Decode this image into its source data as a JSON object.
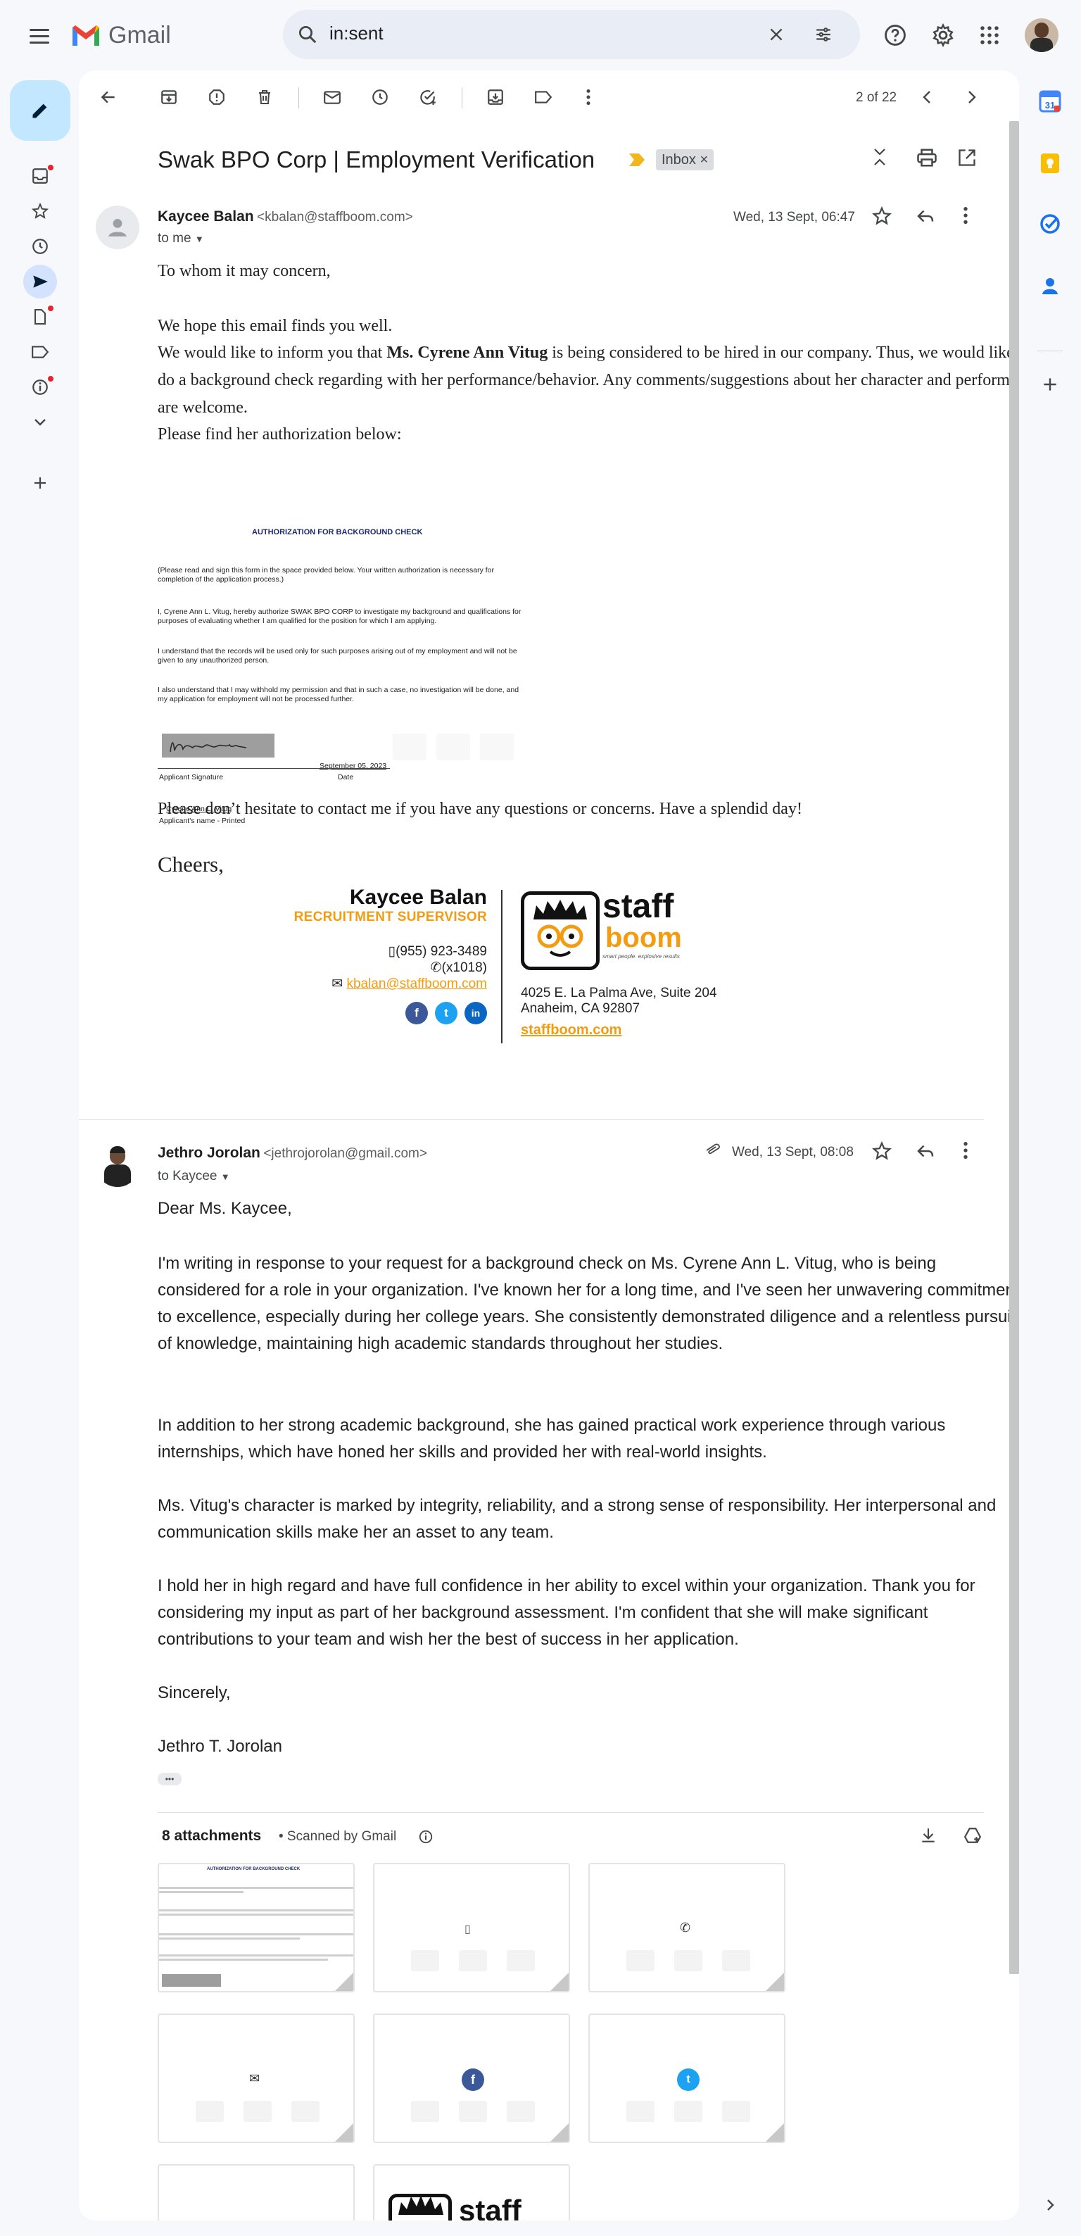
{
  "app": {
    "name": "Gmail"
  },
  "search": {
    "value": "in:sent"
  },
  "toolbar": {
    "pager": "2 of 22"
  },
  "thread": {
    "subject": "Swak BPO Corp | Employment Verification",
    "label": "Inbox"
  },
  "message1": {
    "sender_name": "Kaycee Balan",
    "sender_email": "<kbalan@staffboom.com>",
    "to": "to me",
    "date": "Wed, 13 Sept, 06:47",
    "greeting": "To whom it may concern,",
    "p1": "We hope this email finds you well.",
    "p2_pre": "We would like to inform you that ",
    "p2_bold": "Ms. Cyrene Ann Vitug",
    "p2_post": " is being considered to be hired in our company. Thus, we would like to do a background check regarding with her performance/behavior. Any comments/suggestions about her character and performance are welcome.",
    "p3": "Please find her authorization below:",
    "closing_line": "Please don’t hesitate to contact me if you have any questions or concerns. Have a splendid day!",
    "cheers": "Cheers,"
  },
  "form": {
    "title": "AUTHORIZATION FOR BACKGROUND CHECK",
    "instruction": "(Please read and sign this form in the space provided below. Your written authorization is necessary for completion of the application process.)",
    "para1": "I, Cyrene Ann L. Vitug, hereby authorize SWAK BPO CORP to investigate my background and qualifications for purposes of evaluating whether I am qualified for the position for which I am applying.",
    "para2": "I understand that the records will be used only for such purposes arising out of my employment and will not be given to any unauthorized person.",
    "para3": "I also understand that I may withhold my permission and that in such a case, no investigation will be done, and my application for employment will not be processed further.",
    "date_value": "September 05, 2023",
    "sig_label": "Applicant Signature",
    "date_label": "Date",
    "printed_name": "Cyrene Ann L. Vitug",
    "printed_label": "Applicant's name - Printed"
  },
  "signature": {
    "name": "Kaycee Balan",
    "title": "RECRUITMENT SUPERVISOR",
    "phone": "(955) 923-3489",
    "ext": "(x1018)",
    "email": "kbalan@staffboom.com",
    "address1": "4025 E. La Palma Ave, Suite 204",
    "address2": "Anaheim, CA 92807",
    "website": "staffboom.com",
    "logo_word1": "staff",
    "logo_word2": "boom",
    "tagline": "smart people. explosive results",
    "social": [
      "f",
      "t",
      "in"
    ],
    "brand_color": "#f39c12"
  },
  "message2": {
    "sender_name": "Jethro Jorolan",
    "sender_email": "<jethrojorolan@gmail.com>",
    "to": "to Kaycee",
    "date": "Wed, 13 Sept, 08:08",
    "greeting": "Dear Ms. Kaycee,",
    "p1": "I'm writing in response to your request for a background check on Ms. Cyrene Ann L. Vitug, who is being considered for a role in your organization. I've known her for a long time, and I've seen her unwavering commitment to excellence, especially during her college years. She consistently demonstrated diligence and a relentless pursuit of knowledge, maintaining high academic standards throughout her studies.",
    "p2": "In addition to her strong academic background, she has gained practical work experience through various internships, which have honed her skills and provided her with real-world insights.",
    "p3": "Ms. Vitug's character is marked by integrity, reliability, and a strong sense of responsibility. Her interpersonal and communication skills make her an asset to any team.",
    "p4": "I hold her in high regard and have full confidence in her ability to excel within your organization. Thank you for considering my input as part of her background assessment. I'm confident that she will make significant contributions to your team and wish her the best of success in her application.",
    "closing": "Sincerely,",
    "name": "Jethro T. Jorolan",
    "trimmed": "•••"
  },
  "attachments": {
    "count_label": "8 attachments",
    "scanned": "• Scanned by Gmail",
    "items": [
      "form",
      "phone-icon",
      "phone2-icon",
      "mail-icon",
      "facebook-icon",
      "twitter-icon",
      "blank",
      "logo"
    ]
  },
  "colors": {
    "accent": "#0b57d0",
    "compose_bg": "#c2e7ff",
    "unread_dot": "#e3242b"
  }
}
